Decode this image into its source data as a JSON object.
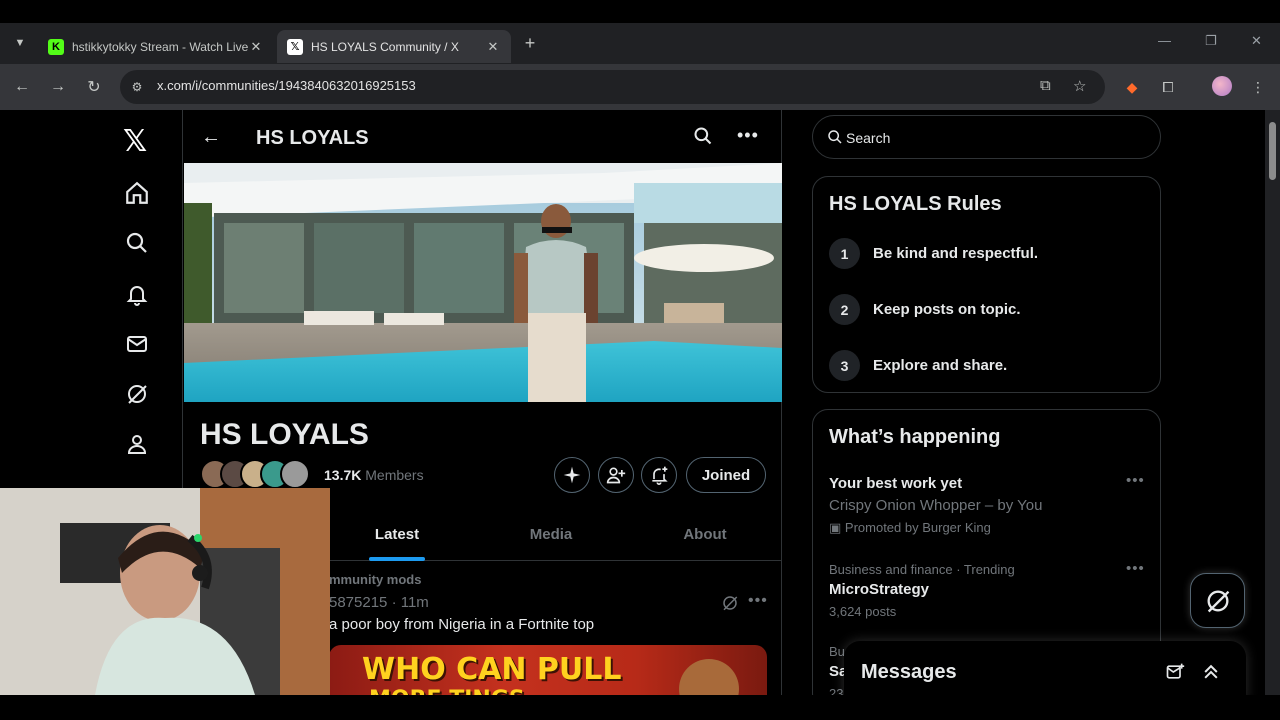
{
  "browser": {
    "tabs": [
      {
        "title": "hstikkytokky Stream - Watch Live",
        "favicon": "kick-logo",
        "favicon_color": "#53fc18",
        "active": false
      },
      {
        "title": "HS LOYALS Community / X",
        "favicon": "x-logo",
        "favicon_color": "#000000",
        "active": true
      }
    ],
    "url": "x.com/i/communities/1943840632016925153"
  },
  "community": {
    "header_title": "HS LOYALS",
    "name": "HS LOYALS",
    "member_count": "13.7K",
    "members_label": "Members",
    "joined_label": "Joined"
  },
  "tabs": [
    {
      "label": "Latest",
      "active": true
    },
    {
      "label": "Media",
      "active": false
    },
    {
      "label": "About",
      "active": false
    }
  ],
  "post": {
    "author_partial": "mmunity mods",
    "meta_partial": "5875215 · 11m",
    "text_partial": "a poor boy from Nigeria in a Fortnite top",
    "media_headline": "WHO CAN PULL",
    "media_headline2": "MORE TINGS"
  },
  "search": {
    "placeholder": "Search"
  },
  "rules": {
    "title": "HS LOYALS Rules",
    "items": [
      {
        "num": "1",
        "text": "Be kind and respectful."
      },
      {
        "num": "2",
        "text": "Keep posts on topic."
      },
      {
        "num": "3",
        "text": "Explore and share."
      }
    ]
  },
  "happening": {
    "title": "What’s happening",
    "items": [
      {
        "title": "Your best work yet",
        "subtitle": "Crispy Onion Whopper – by You",
        "promo": "Promoted by Burger King"
      },
      {
        "category": "Business and finance · Trending",
        "title": "MicroStrategy",
        "count": "3,624 posts"
      },
      {
        "category": "Busi",
        "title": "Sa",
        "count": "23"
      }
    ]
  },
  "messages": {
    "title": "Messages"
  },
  "colors": {
    "accent": "#1d9bf0",
    "background": "#000000",
    "border": "#2f3336",
    "secondary_text": "#71767b"
  }
}
